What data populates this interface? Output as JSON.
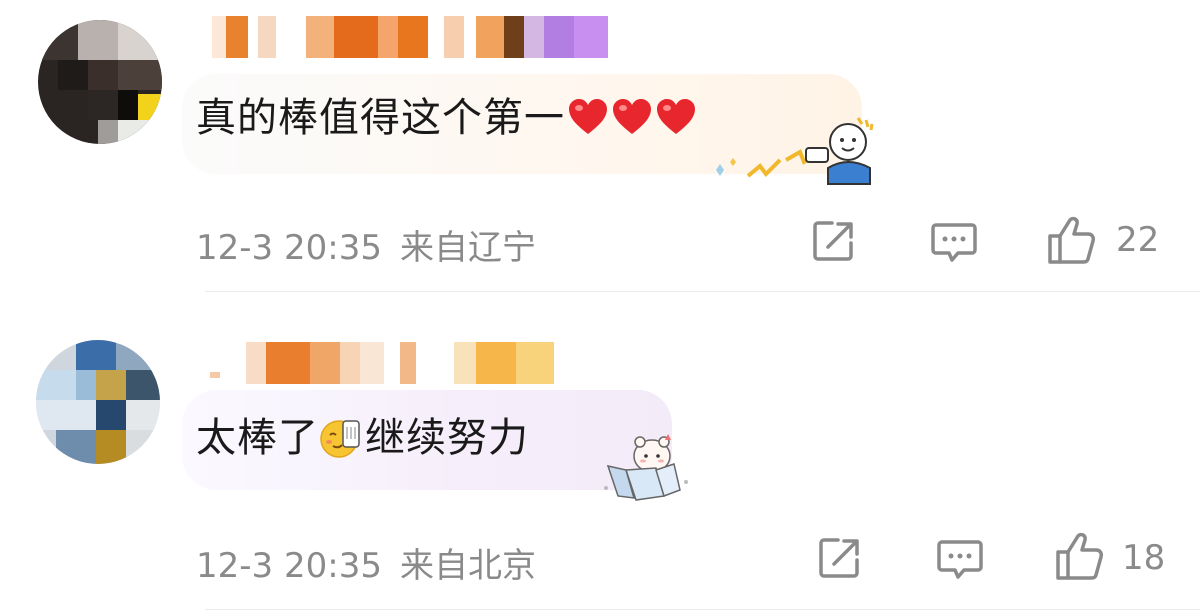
{
  "comments": [
    {
      "text": "真的棒值得这个第一",
      "emoji_names": [
        "heart-emoji",
        "heart-emoji",
        "heart-emoji"
      ],
      "time": "12-3 20:35",
      "location": "来自辽宁",
      "likes": "22"
    },
    {
      "text_before": "太棒了",
      "text_after": "继续努力",
      "emoji_names": [
        "smirk-phone-emoji"
      ],
      "time": "12-3 20:35",
      "location": "来自北京",
      "likes": "18"
    }
  ],
  "icons": {
    "forward": "share-forward-icon",
    "reply": "comment-reply-icon",
    "like": "thumbs-up-icon"
  },
  "colors": {
    "text": "#1a1a1a",
    "meta": "#8a8a8a",
    "heart": "#e8262e"
  }
}
